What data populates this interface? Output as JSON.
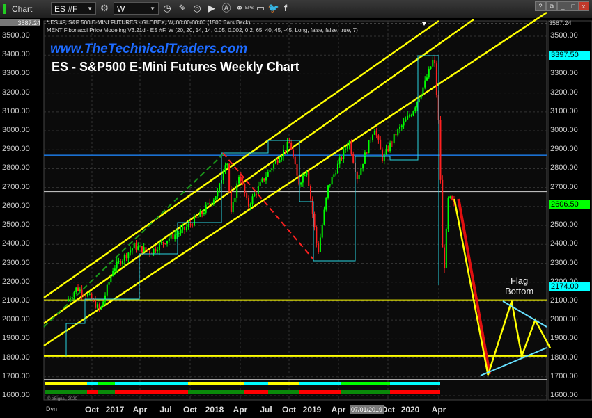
{
  "toolbar": {
    "app_label": "Chart",
    "symbol": "ES #F",
    "interval": "W",
    "eps_label": "EPS",
    "window_help": "?",
    "window_close": "x"
  },
  "chart_info": {
    "line1": "* ES #F, S&P 500 E-MINI FUTURES - GLOBEX, W, 00:00-00:00 (1500 Bars Back)",
    "line2": "MENT Fibonacci Price Modeling V3.21d - ES #F, W (20, 20, 14, 14, 0.05, 0.002, 0.2, 65, 40, 45, -45, Long, false, false, true, 7)",
    "website": "www.TheTechnicalTraders.com",
    "title": "ES - S&P500 E-Mini Futures Weekly Chart",
    "annotation": [
      "Flag",
      "Bottom"
    ],
    "copyright": "© eSignal, 2020",
    "dyn_label": "Dyn"
  },
  "chart_data": {
    "type": "line",
    "title": "ES - S&P500 E-Mini Futures Weekly Chart",
    "ylim": [
      1550,
      3587.24
    ],
    "top_marker": "3587.24",
    "y_ticks": [
      "3500.00",
      "3400.00",
      "3300.00",
      "3200.00",
      "3100.00",
      "3000.00",
      "2900.00",
      "2800.00",
      "2700.00",
      "2600.00",
      "2500.00",
      "2400.00",
      "2300.00",
      "2200.00",
      "2100.00",
      "2000.00",
      "1900.00",
      "1800.00",
      "1700.00",
      "1600.00"
    ],
    "x_ticks": [
      "Oct",
      "2017",
      "Apr",
      "Jul",
      "Oct",
      "2018",
      "Apr",
      "Jul",
      "Oct",
      "2019",
      "Apr",
      "Oct",
      "2020",
      "Apr"
    ],
    "x_cursor_label": "07/01/2019",
    "price_tags": [
      {
        "value": "3397.50",
        "color": "#00ffff"
      },
      {
        "value": "2606.50",
        "color": "#00ff00"
      },
      {
        "value": "2174.00",
        "color": "#00ffff"
      }
    ],
    "series": [
      {
        "name": "ES weekly price",
        "x_months_from_jul2016": [
          0,
          1.2,
          2.5,
          4,
          5.5,
          8,
          10,
          12,
          14,
          16,
          18,
          19,
          19.5,
          20.5,
          21.5,
          23,
          25,
          26.5,
          27.5,
          28.5,
          29.8,
          31,
          33.5,
          34.5,
          36.5,
          37.5,
          39,
          41,
          42.5,
          43.6,
          44.2,
          44.7,
          45.3,
          46
        ],
        "values": [
          2100,
          2170,
          2130,
          2050,
          2270,
          2390,
          2360,
          2430,
          2480,
          2560,
          2680,
          2870,
          2550,
          2780,
          2600,
          2720,
          2850,
          2940,
          2720,
          2800,
          2350,
          2700,
          2950,
          2750,
          3020,
          2850,
          2980,
          3100,
          3250,
          3390,
          3000,
          2200,
          2650,
          2606.5
        ]
      },
      {
        "name": "Projected path (yellow)",
        "x_months_from_jul2016": [
          46,
          50,
          52.8,
          54,
          55.6,
          57.4
        ],
        "values": [
          2640,
          1710,
          2100,
          1810,
          2000,
          1850
        ]
      },
      {
        "name": "Projected decline (red)",
        "x_months_from_jul2016": [
          46.5,
          50.2
        ],
        "values": [
          2640,
          1715
        ]
      }
    ],
    "horizontal_levels": [
      {
        "value": 2105,
        "color": "#ffff00"
      },
      {
        "value": 1810,
        "color": "#ffff00"
      },
      {
        "value": 2680,
        "color": "#bbbbbb"
      },
      {
        "value": 2870,
        "color": "#1a6fd0"
      }
    ],
    "colors": {
      "up": "#00ff00",
      "down": "#ff2020",
      "channel": "#ffff00",
      "flag": "#66e0ff"
    }
  }
}
